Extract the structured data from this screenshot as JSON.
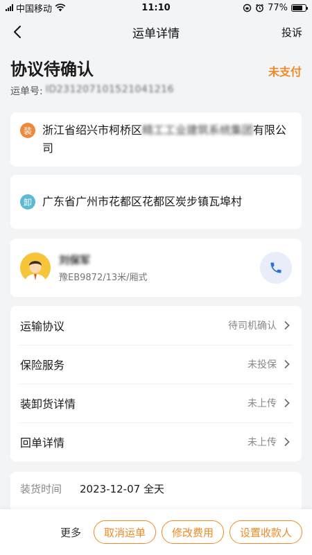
{
  "status_bar": {
    "carrier": "中国移动",
    "time": "11:10",
    "battery_text": "77%",
    "battery_level": 0.77
  },
  "nav": {
    "title": "运单详情",
    "right_action": "投诉"
  },
  "header": {
    "status_title": "协议待确认",
    "payment_status": "未支付",
    "order_label": "运单号:",
    "order_number": "ID231207101521041216"
  },
  "loading": {
    "badge": "装",
    "address_prefix": "浙江省绍兴市柯桥区",
    "address_blurred": "精工工业建筑系统集团",
    "address_suffix": "有限公司"
  },
  "unloading": {
    "badge": "卸",
    "address": "广东省广州市花都区花都区炭步镇瓦埠村"
  },
  "driver": {
    "name": "刘保军",
    "vehicle": "豫EB9872/13米/厢式"
  },
  "menu": [
    {
      "label": "运输协议",
      "value": "待司机确认"
    },
    {
      "label": "保险服务",
      "value": "未投保"
    },
    {
      "label": "装卸货详情",
      "value": "未上传"
    },
    {
      "label": "回单详情",
      "value": "未上传"
    }
  ],
  "info": {
    "load_time_label": "装货时间",
    "load_time_value": "2023-12-07 全天"
  },
  "bottom": {
    "more": "更多",
    "cancel": "取消运单",
    "modify_fee": "修改费用",
    "set_payee": "设置收款人"
  },
  "colors": {
    "accent": "#f08a24",
    "load_badge": "#f0883c",
    "unload_badge": "#5bbad6",
    "phone_icon": "#2f6fd6"
  }
}
